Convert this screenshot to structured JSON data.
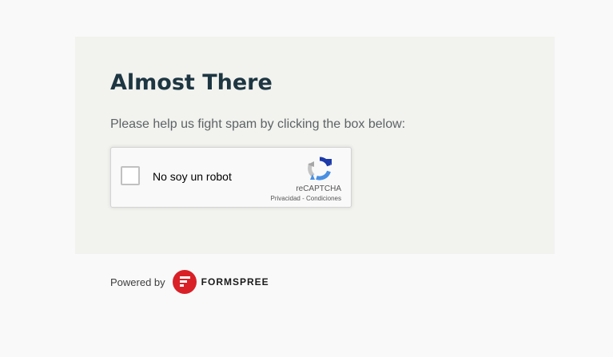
{
  "card": {
    "title": "Almost There",
    "subtitle": "Please help us fight spam by clicking the box below:"
  },
  "recaptcha": {
    "checkbox_label": "No soy un robot",
    "brand": "reCAPTCHA",
    "privacy_link": "Privacidad",
    "separator": " - ",
    "terms_link": "Condiciones",
    "checked": false
  },
  "footer": {
    "powered_by": "Powered by",
    "brand": "FORMSPREE"
  },
  "colors": {
    "page_bg": "#f9f9f9",
    "card_bg": "#f2f2ee",
    "title": "#1d3642",
    "formspree_red": "#d92027"
  },
  "icons": {
    "recaptcha_logo": "recaptcha-logo-icon",
    "formspree_logo": "formspree-logo-icon"
  }
}
